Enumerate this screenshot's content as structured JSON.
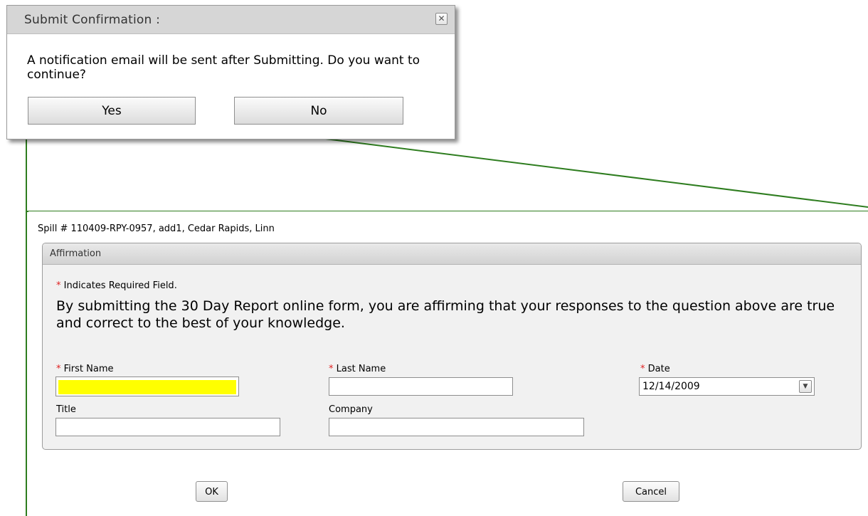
{
  "dialog": {
    "title": "Submit Confirmation :",
    "close_glyph": "✕",
    "message": "A notification email will be sent after Submitting. Do you want to continue?",
    "yes_label": "Yes",
    "no_label": "No"
  },
  "page": {
    "spill_info": "Spill # 110409-RPY-0957, add1, Cedar Rapids, Linn",
    "panel_title": "Affirmation",
    "required_star": "*",
    "required_note": "Indicates Required Field.",
    "affirmation_text": "By submitting the 30 Day Report online form, you are affirming that your responses to the question above are true and correct to the best of your knowledge.",
    "fields": {
      "first_name": {
        "label": "First Name",
        "value": "",
        "highlight_color": "#ffff00"
      },
      "last_name": {
        "label": "Last Name",
        "value": ""
      },
      "date": {
        "label": "Date",
        "value": "12/14/2009"
      },
      "title": {
        "label": "Title",
        "value": ""
      },
      "company": {
        "label": "Company",
        "value": ""
      }
    },
    "ok_label": "OK",
    "cancel_label": "Cancel"
  },
  "colors": {
    "connector_line": "#2e7d1f",
    "required_star": "#e02020",
    "panel_background": "#f1f1f1"
  }
}
